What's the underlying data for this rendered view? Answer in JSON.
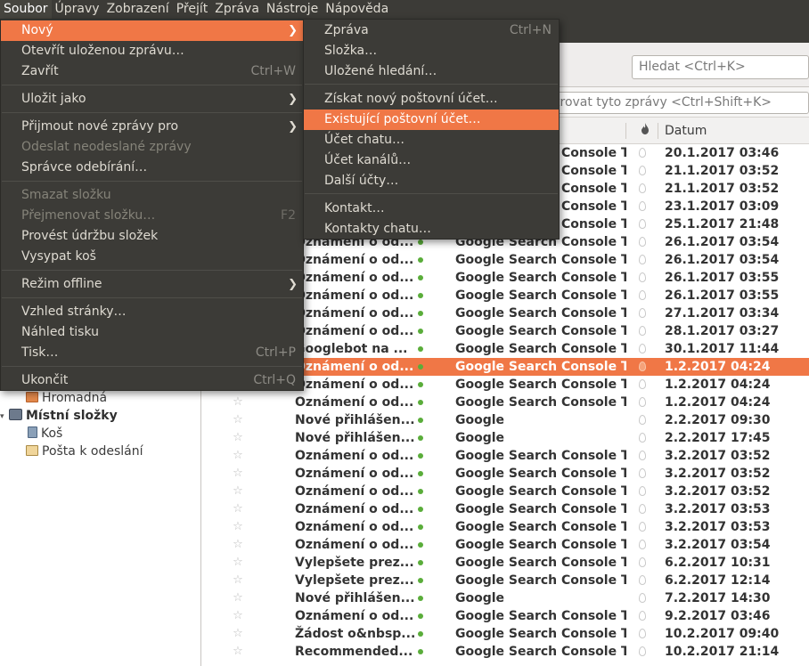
{
  "menubar": {
    "items": [
      "Soubor",
      "Úpravy",
      "Zobrazení",
      "Přejít",
      "Zpráva",
      "Nástroje",
      "Nápověda"
    ]
  },
  "file_menu": {
    "items": [
      {
        "label": "Nový",
        "submenu": true,
        "highlighted": true
      },
      {
        "label": "Otevřít uloženou zprávu…"
      },
      {
        "label": "Zavřít",
        "accel": "Ctrl+W"
      },
      {
        "label": "Uložit jako",
        "submenu": true
      },
      {
        "label": "Přijmout nové zprávy pro",
        "submenu": true
      },
      {
        "label": "Odeslat neodeslané zprávy",
        "disabled": true
      },
      {
        "label": "Správce odebírání…"
      },
      {
        "label": "Smazat složku",
        "disabled": true
      },
      {
        "label": "Přejmenovat složku…",
        "accel": "F2",
        "disabled": true
      },
      {
        "label": "Provést údržbu složek"
      },
      {
        "label": "Vysypat koš"
      },
      {
        "label": "Režim offline",
        "submenu": true
      },
      {
        "label": "Vzhled stránky…"
      },
      {
        "label": "Náhled tisku"
      },
      {
        "label": "Tisk…",
        "accel": "Ctrl+P"
      },
      {
        "label": "Ukončit",
        "accel": "Ctrl+Q"
      }
    ]
  },
  "new_submenu": {
    "items": [
      {
        "label": "Zpráva",
        "accel": "Ctrl+N"
      },
      {
        "label": "Složka…"
      },
      {
        "label": "Uložené hledání…"
      },
      {
        "label": "Získat nový poštovní účet…"
      },
      {
        "label": "Existující poštovní účet…",
        "highlighted": true
      },
      {
        "label": "Účet chatu…"
      },
      {
        "label": "Účet kanálů…"
      },
      {
        "label": "Další účty…"
      },
      {
        "label": "Kontakt…"
      },
      {
        "label": "Kontakty chatu…"
      }
    ]
  },
  "search": {
    "placeholder": "Hledat <Ctrl+K>"
  },
  "filter": {
    "placeholder": "trovat tyto zprávy <Ctrl+Shift+K>"
  },
  "columns": {
    "date": "Datum"
  },
  "folders": {
    "hromadna": "Hromadná",
    "local": "Místní složky",
    "trash": "Koš",
    "outbox": "Pošta k odeslání"
  },
  "messages": [
    {
      "subject": "",
      "correspondent": "Google Search Console T...",
      "date": "20.1.2017 03:46"
    },
    {
      "subject": "",
      "correspondent": "Google Search Console T...",
      "date": "21.1.2017 03:52"
    },
    {
      "subject": "",
      "correspondent": "Google Search Console T...",
      "date": "21.1.2017 03:52"
    },
    {
      "subject": "",
      "correspondent": "Google Search Console T...",
      "date": "23.1.2017 03:09"
    },
    {
      "subject": "",
      "correspondent": "Google Search Console T...",
      "date": "25.1.2017 21:48"
    },
    {
      "subject": "Oznámení o od...",
      "correspondent": "Google Search Console T...",
      "date": "26.1.2017 03:54"
    },
    {
      "subject": "Oznámení o od...",
      "correspondent": "Google Search Console T...",
      "date": "26.1.2017 03:54"
    },
    {
      "subject": "Oznámení o od...",
      "correspondent": "Google Search Console T...",
      "date": "26.1.2017 03:55"
    },
    {
      "subject": "Oznámení o od...",
      "correspondent": "Google Search Console T...",
      "date": "26.1.2017 03:55"
    },
    {
      "subject": "Oznámení o od...",
      "correspondent": "Google Search Console T...",
      "date": "27.1.2017 03:34"
    },
    {
      "subject": "Oznámení o od...",
      "correspondent": "Google Search Console T...",
      "date": "28.1.2017 03:27"
    },
    {
      "subject": "Googlebot na ...",
      "correspondent": "Google Search Console T...",
      "date": "30.1.2017 11:44"
    },
    {
      "subject": "Oznámení o od...",
      "correspondent": "Google Search Console T...",
      "date": "1.2.2017 04:24",
      "selected": true
    },
    {
      "subject": "Oznámení o od...",
      "correspondent": "Google Search Console T...",
      "date": "1.2.2017 04:24"
    },
    {
      "subject": "Oznámení o od...",
      "correspondent": "Google Search Console T...",
      "date": "1.2.2017 04:24"
    },
    {
      "subject": "Nové přihlášen...",
      "correspondent": "Google",
      "date": "2.2.2017 09:30"
    },
    {
      "subject": "Nové přihlášen...",
      "correspondent": "Google",
      "date": "2.2.2017 17:45"
    },
    {
      "subject": "Oznámení o od...",
      "correspondent": "Google Search Console T...",
      "date": "3.2.2017 03:52"
    },
    {
      "subject": "Oznámení o od...",
      "correspondent": "Google Search Console T...",
      "date": "3.2.2017 03:52"
    },
    {
      "subject": "Oznámení o od...",
      "correspondent": "Google Search Console T...",
      "date": "3.2.2017 03:52"
    },
    {
      "subject": "Oznámení o od...",
      "correspondent": "Google Search Console T...",
      "date": "3.2.2017 03:53"
    },
    {
      "subject": "Oznámení o od...",
      "correspondent": "Google Search Console T...",
      "date": "3.2.2017 03:53"
    },
    {
      "subject": "Oznámení o od...",
      "correspondent": "Google Search Console T...",
      "date": "3.2.2017 03:54"
    },
    {
      "subject": "Vylepšete prez...",
      "correspondent": "Google Search Console T...",
      "date": "6.2.2017 10:31"
    },
    {
      "subject": "Vylepšete prez...",
      "correspondent": "Google Search Console T...",
      "date": "6.2.2017 12:14"
    },
    {
      "subject": "Nové přihlášen...",
      "correspondent": "Google",
      "date": "7.2.2017 14:30"
    },
    {
      "subject": "Oznámení o od...",
      "correspondent": "Google Search Console T...",
      "date": "9.2.2017 03:46"
    },
    {
      "subject": "Žádost o&nbsp...",
      "correspondent": "Google Search Console T...",
      "date": "10.2.2017 09:40"
    },
    {
      "subject": "Recommended...",
      "correspondent": "Google Search Console T...",
      "date": "10.2.2017 21:14"
    }
  ]
}
